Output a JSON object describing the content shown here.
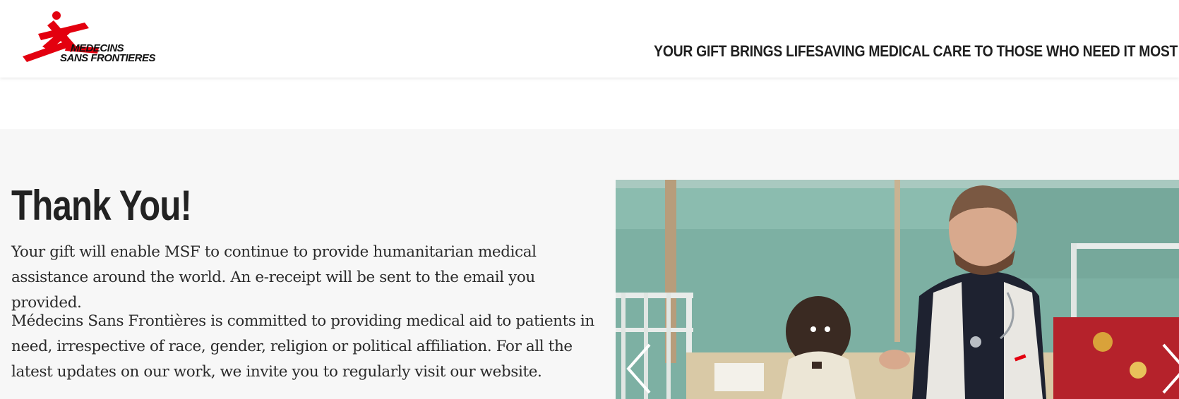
{
  "header": {
    "logo": {
      "line1": "MEDECINS",
      "line2": "SANS FRONTIERES",
      "brand_color": "#e3000f"
    },
    "tagline": "YOUR GIFT BRINGS LIFESAVING MEDICAL CARE TO THOSE WHO NEED IT MOST"
  },
  "main": {
    "title": "Thank You!",
    "paragraph1": "Your gift will enable MSF to continue to provide humanitarian medical assistance around the world. An e-receipt will be sent to the email you provided.",
    "paragraph2": "Médecins Sans Frontières is committed to providing medical aid to patients in need, irrespective of race, gender, religion or political affiliation. For all the latest updates on our work, we invite you to regularly visit our website."
  },
  "carousel": {
    "prev_icon": "chevron-left-icon",
    "next_icon": "chevron-right-icon"
  },
  "colors": {
    "header_bg": "#ffffff",
    "section_bg": "#f7f7f7",
    "text": "#222222",
    "brand_red": "#e3000f"
  }
}
